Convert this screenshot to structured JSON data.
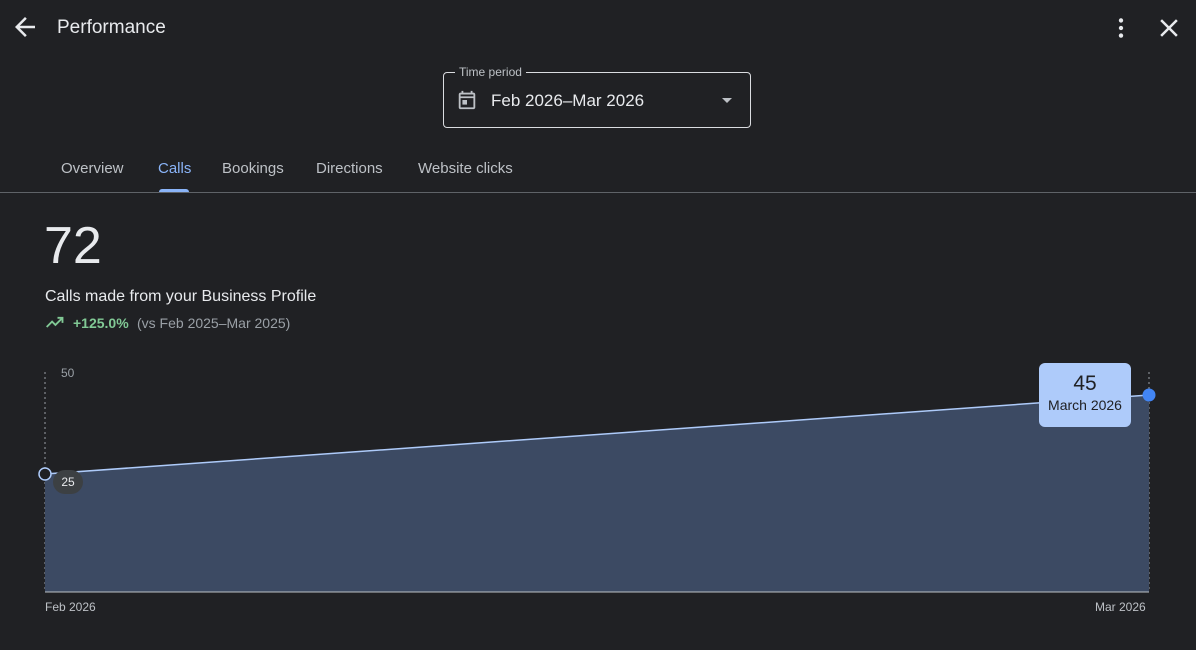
{
  "header": {
    "title": "Performance",
    "icons": {
      "back": "arrow-back-icon",
      "more": "more-vert-icon",
      "close": "close-icon"
    }
  },
  "time_period": {
    "legend": "Time period",
    "value": "Feb 2026–Mar 2026",
    "icon": "calendar-icon"
  },
  "tabs": [
    {
      "label": "Overview",
      "active": false
    },
    {
      "label": "Calls",
      "active": true
    },
    {
      "label": "Bookings",
      "active": false
    },
    {
      "label": "Directions",
      "active": false
    },
    {
      "label": "Website clicks",
      "active": false
    }
  ],
  "metric": {
    "value": "72",
    "label": "Calls made from your Business Profile",
    "change": "+125.0%",
    "comparison": "(vs Feb 2025–Mar 2025)"
  },
  "chart_data": {
    "type": "area",
    "categories": [
      "Feb 2026",
      "Mar 2026"
    ],
    "values": [
      25,
      45
    ],
    "y_ticks": [
      50
    ],
    "ylim": [
      0,
      50
    ],
    "selected": {
      "value": "45",
      "label": "March 2026"
    },
    "hovered_start_label": "25"
  },
  "colors": {
    "background": "#202124",
    "accent": "#8ab4f8",
    "positive": "#81c995",
    "area_fill": "#3c4a63",
    "tooltip_bg": "#aecbfa"
  }
}
